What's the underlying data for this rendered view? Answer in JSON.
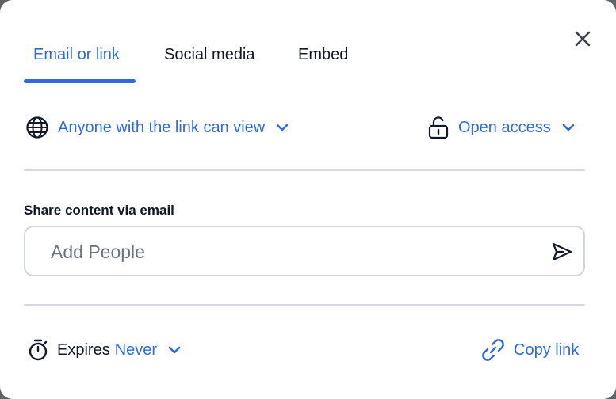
{
  "tabs": [
    {
      "label": "Email or link",
      "active": true
    },
    {
      "label": "Social media",
      "active": false
    },
    {
      "label": "Embed",
      "active": false
    }
  ],
  "access": {
    "link_permission": "Anyone with the link can view",
    "access_level": "Open access"
  },
  "email": {
    "section_label": "Share content via email",
    "placeholder": "Add People",
    "value": ""
  },
  "footer": {
    "expires_label": "Expires",
    "expires_value": "Never",
    "copy_link_label": "Copy link"
  },
  "colors": {
    "accent": "#2f6bde",
    "text": "#111827",
    "divider": "#d4dae3",
    "border": "#d0d5dd"
  },
  "icons": {
    "close": "close-icon",
    "globe": "globe-icon",
    "unlock": "unlock-icon",
    "send": "send-icon",
    "timer": "stopwatch-icon",
    "link": "link-icon",
    "chevron": "chevron-down-icon"
  }
}
